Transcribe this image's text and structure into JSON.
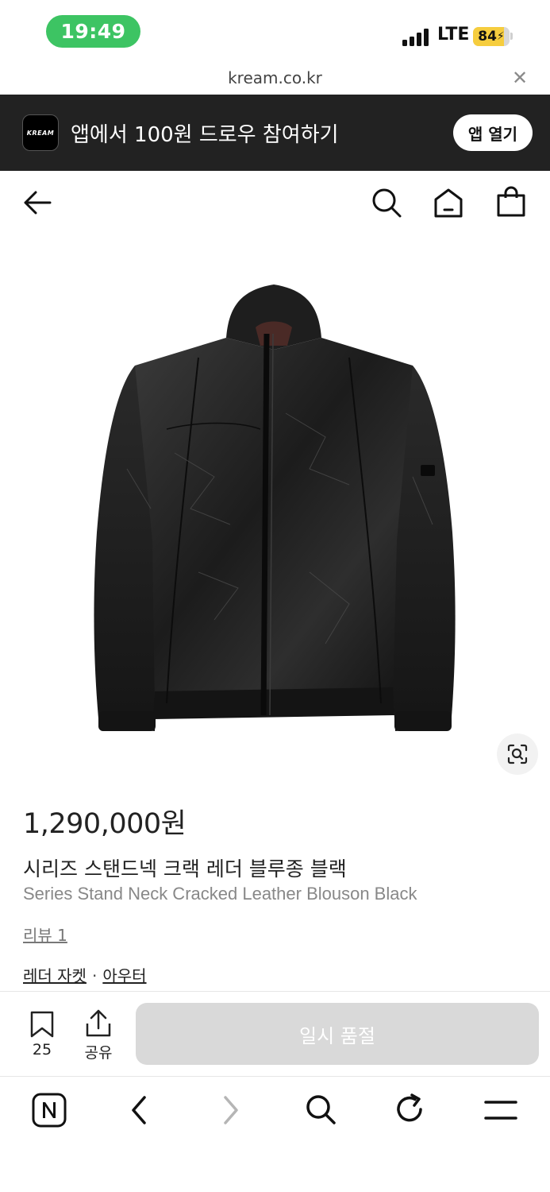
{
  "status_bar": {
    "time": "19:49",
    "network": "LTE",
    "battery": "84",
    "battery_level": 0.84,
    "time_pill_color": "#3dc463"
  },
  "url_bar": {
    "url": "kream.co.kr",
    "close_icon": "close-icon"
  },
  "app_banner": {
    "logo_text": "KREAM",
    "message": "앱에서 100원 드로우 참여하기",
    "open_button": "앱 열기"
  },
  "nav": {
    "back_icon": "back-arrow-icon",
    "search_icon": "search-icon",
    "home_icon": "home-icon",
    "cart_icon": "shopping-bag-icon"
  },
  "product": {
    "image_icon": "leather-jacket-image",
    "lens_icon": "visual-search-icon",
    "price": "1,290,000원",
    "name_ko": "시리즈 스탠드넥 크랙 레더 블루종 블랙",
    "name_en": "Series Stand Neck Cracked Leather Blouson Black",
    "review_link": "리뷰 1",
    "categories": [
      "레더 자켓",
      "아우터"
    ],
    "category_separator": "·"
  },
  "actions": {
    "wish_icon": "bookmark-icon",
    "wish_count": "25",
    "share_icon": "share-icon",
    "share_label": "공유",
    "buy_button": "일시 품절",
    "buy_button_color": "#d9d9d9"
  },
  "toolbar": {
    "items": [
      "naver-home-icon",
      "back-icon",
      "forward-icon",
      "search-icon",
      "reload-icon",
      "menu-icon"
    ]
  }
}
